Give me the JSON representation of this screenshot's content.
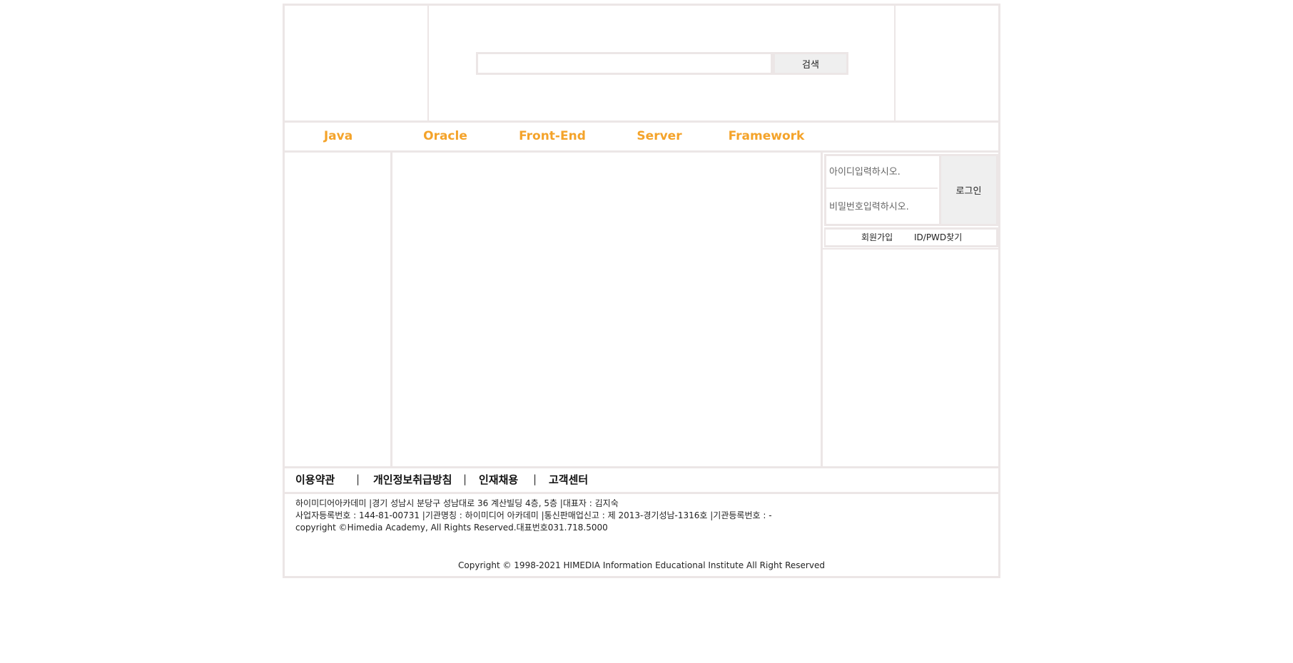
{
  "search": {
    "placeholder": "",
    "button_label": "검색"
  },
  "nav": {
    "items": [
      {
        "label": "Java"
      },
      {
        "label": "Oracle"
      },
      {
        "label": "Front-End"
      },
      {
        "label": "Server"
      },
      {
        "label": "Framework"
      }
    ]
  },
  "login": {
    "id_placeholder": "아이디입력하시오.",
    "pw_placeholder": "비밀번호입력하시오.",
    "button_label": "로그인",
    "signup_label": "회원가입",
    "find_label": "ID/PWD찾기"
  },
  "footer": {
    "links": [
      {
        "label": "이용약관"
      },
      {
        "label": "개인정보취급방침"
      },
      {
        "label": "인재채용"
      },
      {
        "label": "고객센터"
      }
    ],
    "separator": "|",
    "info_lines": [
      "하이미디어아카데미 |경기 성남시 분당구 성남대로 36 계산빌딩 4층, 5층 |대표자 : 김지숙",
      "사업자등록번호 : 144-81-00731 |기관명칭 : 하이미디어 아카데미 |통신판매업신고 : 제 2013-경기성남-1316호 |기관등록번호 : -",
      "copyright ©Himedia Academy, All Rights Reserved.대표번호031.718.5000"
    ],
    "copyright": "Copyright © 1998-2021 HIMEDIA Information Educational Institute All Right Reserved"
  }
}
